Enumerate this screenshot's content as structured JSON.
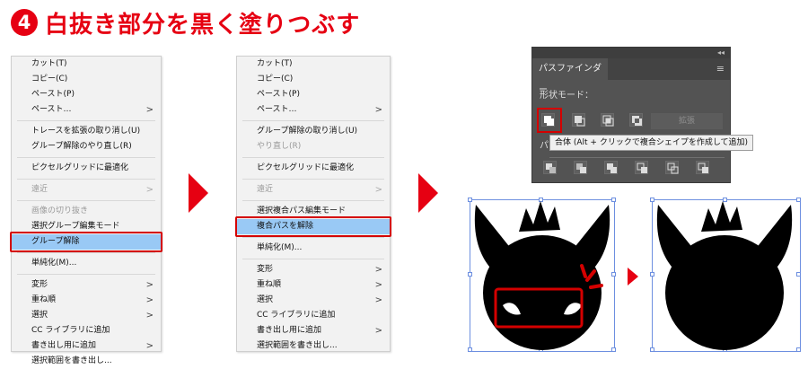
{
  "title": {
    "step": "4",
    "text": "白抜き部分を黒く塗りつぶす"
  },
  "menu1": {
    "items": [
      {
        "label": "カット(T)"
      },
      {
        "label": "コピー(C)"
      },
      {
        "label": "ペースト(P)"
      },
      {
        "label": "ペースト…",
        "arrow": ">"
      },
      {
        "sep": true
      },
      {
        "label": "トレースを拡張の取り消し(U)"
      },
      {
        "label": "グループ解除のやり直し(R)"
      },
      {
        "sep": true
      },
      {
        "label": "ピクセルグリッドに最適化"
      },
      {
        "sep": true
      },
      {
        "label": "遠近",
        "arrow": ">",
        "disabled": true
      },
      {
        "sep": true
      },
      {
        "label": "画像の切り抜き",
        "disabled": true
      },
      {
        "label": "選択グループ編集モード"
      },
      {
        "label": "グループ解除",
        "highlight": true
      },
      {
        "sep": true
      },
      {
        "label": "単純化(M)..."
      },
      {
        "sep": true
      },
      {
        "label": "変形",
        "arrow": ">"
      },
      {
        "label": "重ね順",
        "arrow": ">"
      },
      {
        "label": "選択",
        "arrow": ">"
      },
      {
        "label": "CC ライブラリに追加"
      },
      {
        "label": "書き出し用に追加",
        "arrow": ">"
      },
      {
        "label": "選択範囲を書き出し..."
      }
    ]
  },
  "menu2": {
    "items": [
      {
        "label": "カット(T)"
      },
      {
        "label": "コピー(C)"
      },
      {
        "label": "ペースト(P)"
      },
      {
        "label": "ペースト…",
        "arrow": ">"
      },
      {
        "sep": true
      },
      {
        "label": "グループ解除の取り消し(U)"
      },
      {
        "label": "やり直し(R)",
        "disabled": true
      },
      {
        "sep": true
      },
      {
        "label": "ピクセルグリッドに最適化"
      },
      {
        "sep": true
      },
      {
        "label": "遠近",
        "arrow": ">",
        "disabled": true
      },
      {
        "sep": true
      },
      {
        "label": "選択複合パス編集モード"
      },
      {
        "label": "複合パスを解除",
        "highlight": true
      },
      {
        "sep": true
      },
      {
        "label": "単純化(M)..."
      },
      {
        "sep": true
      },
      {
        "label": "変形",
        "arrow": ">"
      },
      {
        "label": "重ね順",
        "arrow": ">"
      },
      {
        "label": "選択",
        "arrow": ">"
      },
      {
        "label": "CC ライブラリに追加"
      },
      {
        "label": "書き出し用に追加",
        "arrow": ">"
      },
      {
        "label": "選択範囲を書き出し..."
      }
    ]
  },
  "pathfinder": {
    "collapse": "◂◂",
    "tab": "パスファインダー",
    "menu_icon": "≡",
    "shape_mode_label": "形状モード：",
    "expand_label": "拡張",
    "pathfinder_label": "パ",
    "tooltip": "合体 (Alt + クリックで複合シェイプを作成して追加)"
  },
  "colors": {
    "accent": "#e60012",
    "highlight": "#99c9f5",
    "selection": "#6d8fe0",
    "panel": "#535353"
  }
}
